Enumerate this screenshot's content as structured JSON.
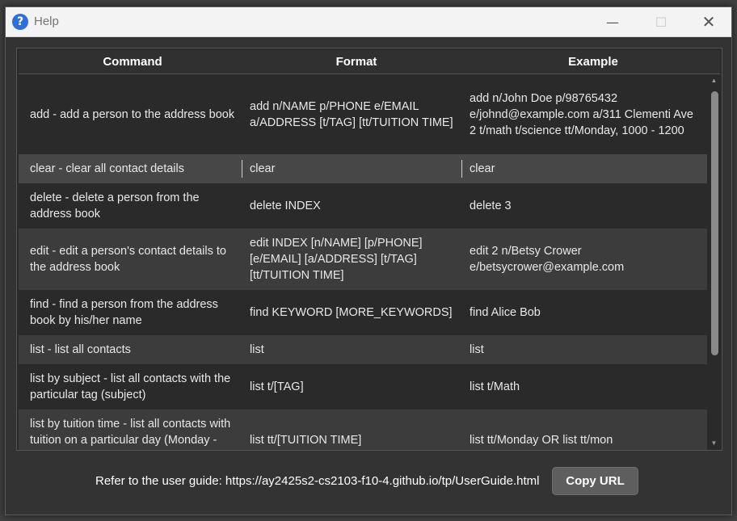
{
  "window": {
    "title": "Help",
    "app_icon_glyph": "?"
  },
  "controls": {
    "minimize": "—",
    "maximize": "☐",
    "close": "✕"
  },
  "table": {
    "columns": [
      "Command",
      "Format",
      "Example"
    ],
    "rows": [
      {
        "command": "add - add a person to the address book",
        "format": "add n/NAME p/PHONE e/EMAIL a/ADDRESS [t/TAG] [tt/TUITION TIME]",
        "example": "add n/John Doe p/98765432 e/johnd@example.com a/311 Clementi Ave 2 t/math t/science tt/Monday, 1000 - 1200"
      },
      {
        "command": "clear - clear all contact details",
        "format": "clear",
        "example": "clear"
      },
      {
        "command": "delete - delete a person from the address book",
        "format": "delete INDEX",
        "example": "delete 3"
      },
      {
        "command": "edit - edit a person's contact details to the address book",
        "format": "edit INDEX [n/NAME] [p/PHONE] [e/EMAIL] [a/ADDRESS] [t/TAG] [tt/TUITION TIME]",
        "example": "edit 2 n/Betsy Crower e/betsycrower@example.com"
      },
      {
        "command": "find - find a person from the address book by his/her name",
        "format": "find KEYWORD [MORE_KEYWORDS]",
        "example": "find Alice Bob"
      },
      {
        "command": "list - list all contacts",
        "format": "list",
        "example": "list"
      },
      {
        "command": "list by subject - list all contacts with the particular tag (subject)",
        "format": "list t/[TAG]",
        "example": "list t/Math"
      },
      {
        "command": "list by tuition time - list all contacts with tuition on a particular day (Monday - Sunday)",
        "format": "list tt/[TUITION TIME]",
        "example": "list tt/Monday OR list tt/mon"
      }
    ]
  },
  "footer": {
    "guide_text": "Refer to the user guide: https://ay2425s2-cs2103-f10-4.github.io/tp/UserGuide.html",
    "copy_button": "Copy URL"
  }
}
